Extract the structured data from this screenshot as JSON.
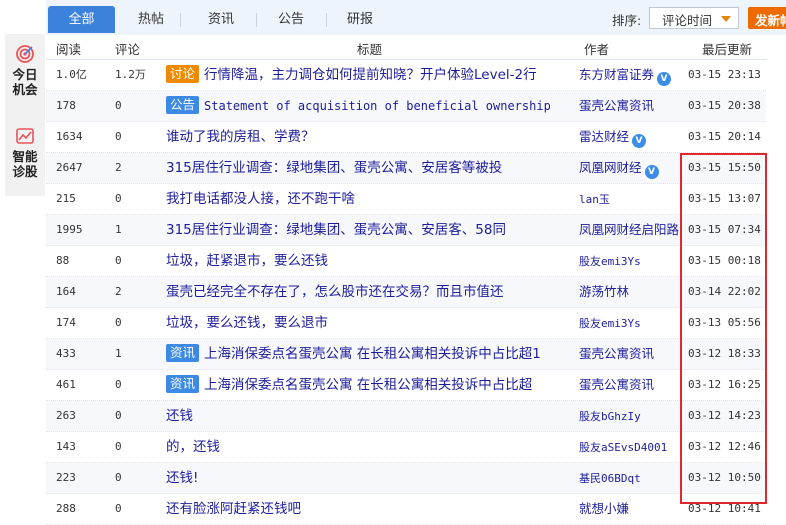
{
  "tabs": [
    {
      "label": "全部",
      "active": true
    },
    {
      "label": "热帖"
    },
    {
      "label": "资讯"
    },
    {
      "label": "公告"
    },
    {
      "label": "研报"
    }
  ],
  "sort": {
    "label": "排序:",
    "selected": "评论时间"
  },
  "post_button": {
    "label": "发新帖"
  },
  "sidebar": [
    {
      "label_line1": "今日",
      "label_line2": "机会",
      "icon": "target-icon"
    },
    {
      "label_line1": "智能",
      "label_line2": "诊股",
      "icon": "chart-icon"
    }
  ],
  "columns": {
    "read": "阅读",
    "comment": "评论",
    "title": "标题",
    "author": "作者",
    "updated": "最后更新"
  },
  "colors": {
    "accent": "#3c82dc",
    "post_button": "#ef6a00",
    "tag_orange": "#ef8a00",
    "tag_blue": "#3c8ae6",
    "highlight": "#e0282c"
  },
  "rows": [
    {
      "read": "1.0亿",
      "comment": "1.2万",
      "tag": "讨论",
      "tag_color": "orange",
      "title": "行情降温，主力调仓如何提前知晓？开户体验Level-2行",
      "author": "东方财富证券",
      "verified": true,
      "time": "03-15 23:13"
    },
    {
      "read": "178",
      "comment": "0",
      "tag": "公告",
      "tag_color": "blue",
      "title": "Statement of acquisition of beneficial ownership b",
      "title_en": true,
      "author": "蛋壳公寓资讯",
      "verified": false,
      "time": "03-15 20:38"
    },
    {
      "read": "1634",
      "comment": "0",
      "tag": "",
      "title": "谁动了我的房租、学费？",
      "author": "雷达财经",
      "verified": true,
      "time": "03-15 20:14"
    },
    {
      "read": "2647",
      "comment": "2",
      "tag": "",
      "title": "315居住行业调查：绿地集团、蛋壳公寓、安居客等被投",
      "author": "凤凰网财经",
      "verified": true,
      "time": "03-15 15:50"
    },
    {
      "read": "215",
      "comment": "0",
      "tag": "",
      "title": "我打电话都没人接，还不跑干啥",
      "author": "lan玉",
      "verified": false,
      "time": "03-15 13:07"
    },
    {
      "read": "1995",
      "comment": "1",
      "tag": "",
      "title": "315居住行业调查：绿地集团、蛋壳公寓、安居客、58同",
      "author": "凤凰网财经启阳路",
      "verified": false,
      "time": "03-15 07:34"
    },
    {
      "read": "88",
      "comment": "0",
      "tag": "",
      "title": "垃圾，赶紧退市，要么还钱",
      "author": "股友emi3Ys",
      "verified": false,
      "time": "03-15 00:18"
    },
    {
      "read": "164",
      "comment": "2",
      "tag": "",
      "title": "蛋壳已经完全不存在了，怎么股市还在交易？而且市值还",
      "author": "游荡竹林",
      "verified": false,
      "time": "03-14 22:02"
    },
    {
      "read": "174",
      "comment": "0",
      "tag": "",
      "title": "垃圾，要么还钱，要么退市",
      "author": "股友emi3Ys",
      "verified": false,
      "time": "03-13 05:56"
    },
    {
      "read": "433",
      "comment": "1",
      "tag": "资讯",
      "tag_color": "blue",
      "title": "上海消保委点名蛋壳公寓 在长租公寓相关投诉中占比超1",
      "author": "蛋壳公寓资讯",
      "verified": false,
      "time": "03-12 18:33"
    },
    {
      "read": "461",
      "comment": "0",
      "tag": "资讯",
      "tag_color": "blue",
      "title": "上海消保委点名蛋壳公寓 在长租公寓相关投诉中占比超",
      "author": "蛋壳公寓资讯",
      "verified": false,
      "time": "03-12 16:25"
    },
    {
      "read": "263",
      "comment": "0",
      "tag": "",
      "title": "还钱",
      "author": "股友bGhzIy",
      "verified": false,
      "time": "03-12 14:23"
    },
    {
      "read": "143",
      "comment": "0",
      "tag": "",
      "title": "的，还钱",
      "author": "股友aSEvsD4001",
      "verified": false,
      "time": "03-12 12:46"
    },
    {
      "read": "223",
      "comment": "0",
      "tag": "",
      "title": "还钱!",
      "author": "基民06BDqt",
      "verified": false,
      "time": "03-12 10:50"
    },
    {
      "read": "288",
      "comment": "0",
      "tag": "",
      "title": "还有脸涨阿赶紧还钱吧",
      "author": "就想小嫌",
      "verified": false,
      "time": "03-12 10:41"
    }
  ]
}
